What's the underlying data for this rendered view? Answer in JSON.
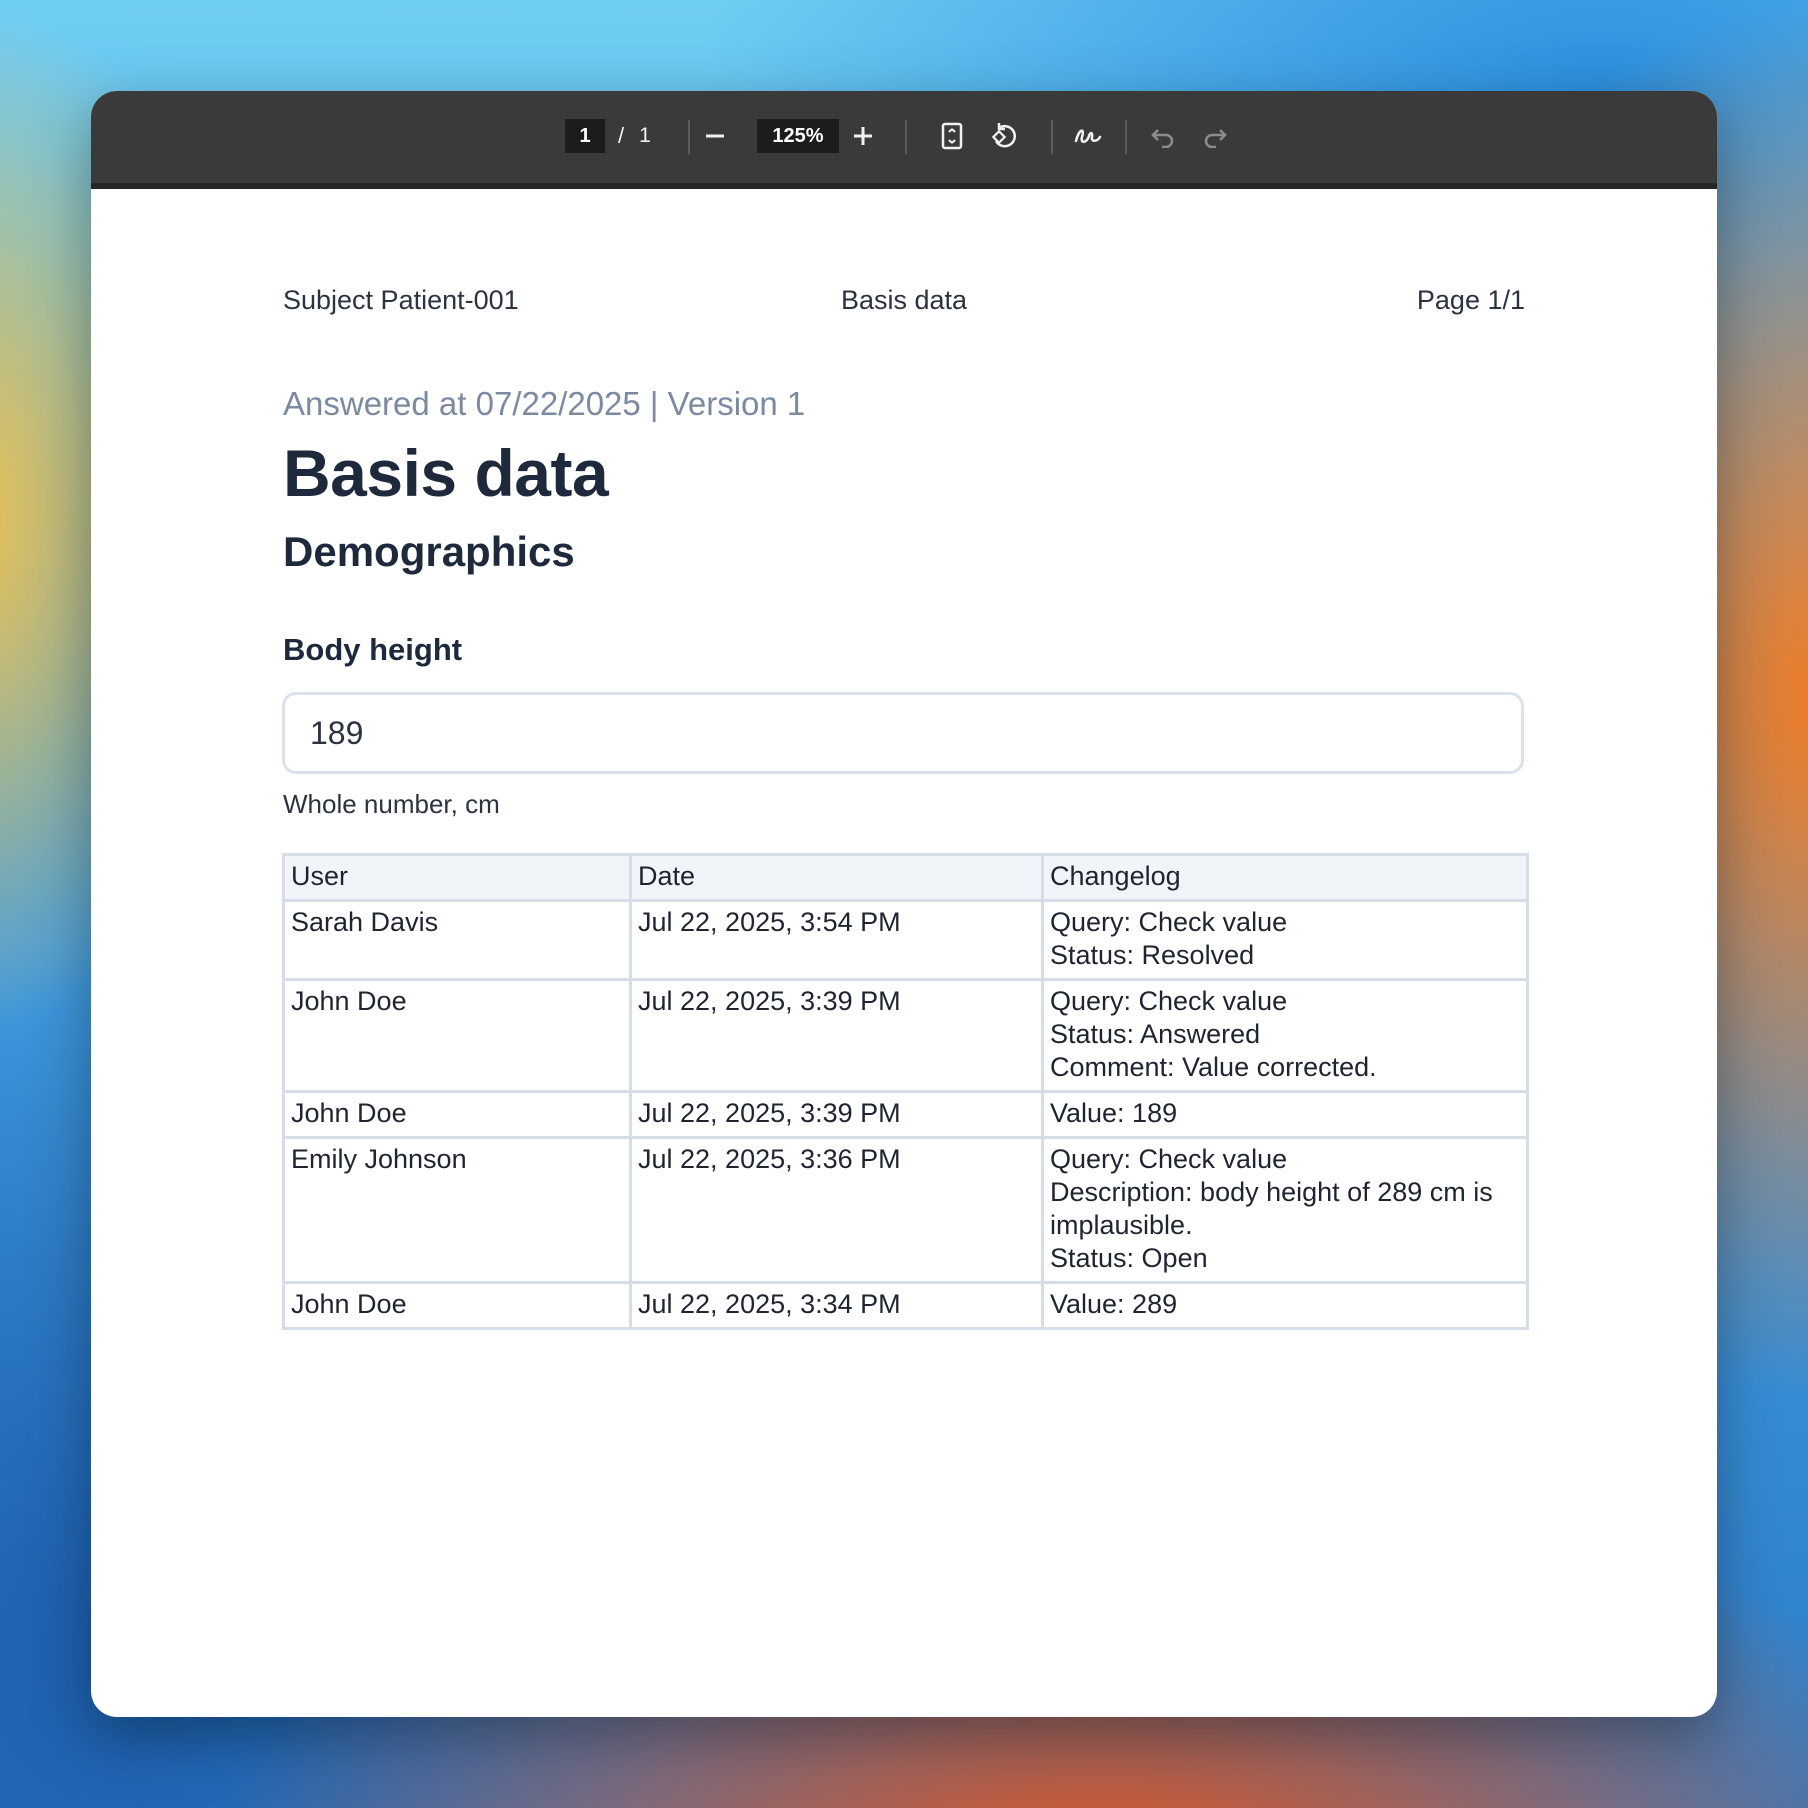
{
  "toolbar": {
    "current_page": "1",
    "page_separator": "/",
    "total_pages": "1",
    "zoom": "125%",
    "icons": [
      "zoom-out-icon",
      "zoom-in-icon",
      "fit-page-icon",
      "rotate-icon",
      "draw-icon",
      "undo-icon",
      "redo-icon"
    ]
  },
  "running_header": {
    "left": "Subject Patient-001",
    "center": "Basis data",
    "right": "Page 1/1"
  },
  "document": {
    "meta": "Answered at 07/22/2025 | Version 1",
    "title": "Basis data",
    "section": "Demographics",
    "field": {
      "label": "Body height",
      "value": "189",
      "hint": "Whole number, cm"
    }
  },
  "changelog": {
    "headers": [
      "User",
      "Date",
      "Changelog"
    ],
    "rows": [
      {
        "user": "Sarah Davis",
        "date": "Jul 22, 2025, 3:54 PM",
        "log": [
          "Query: Check value",
          "Status: Resolved"
        ]
      },
      {
        "user": "John Doe",
        "date": "Jul 22, 2025, 3:39 PM",
        "log": [
          "Query: Check value",
          "Status: Answered",
          "Comment: Value corrected."
        ]
      },
      {
        "user": "John Doe",
        "date": "Jul 22, 2025, 3:39 PM",
        "log": [
          "Value: 189"
        ]
      },
      {
        "user": "Emily Johnson",
        "date": "Jul 22, 2025, 3:36 PM",
        "log": [
          "Query: Check value",
          "Description: body height of 289 cm is implausible.",
          "Status: Open"
        ]
      },
      {
        "user": "John Doe",
        "date": "Jul 22, 2025, 3:34 PM",
        "log": [
          "Value: 289"
        ]
      }
    ]
  },
  "colors": {
    "toolbar_bg": "#3a3a3a",
    "text_primary": "#1e293b",
    "text_muted": "#7b8aa0",
    "table_border": "#d6dde8",
    "table_header_bg": "#f1f4f9"
  }
}
